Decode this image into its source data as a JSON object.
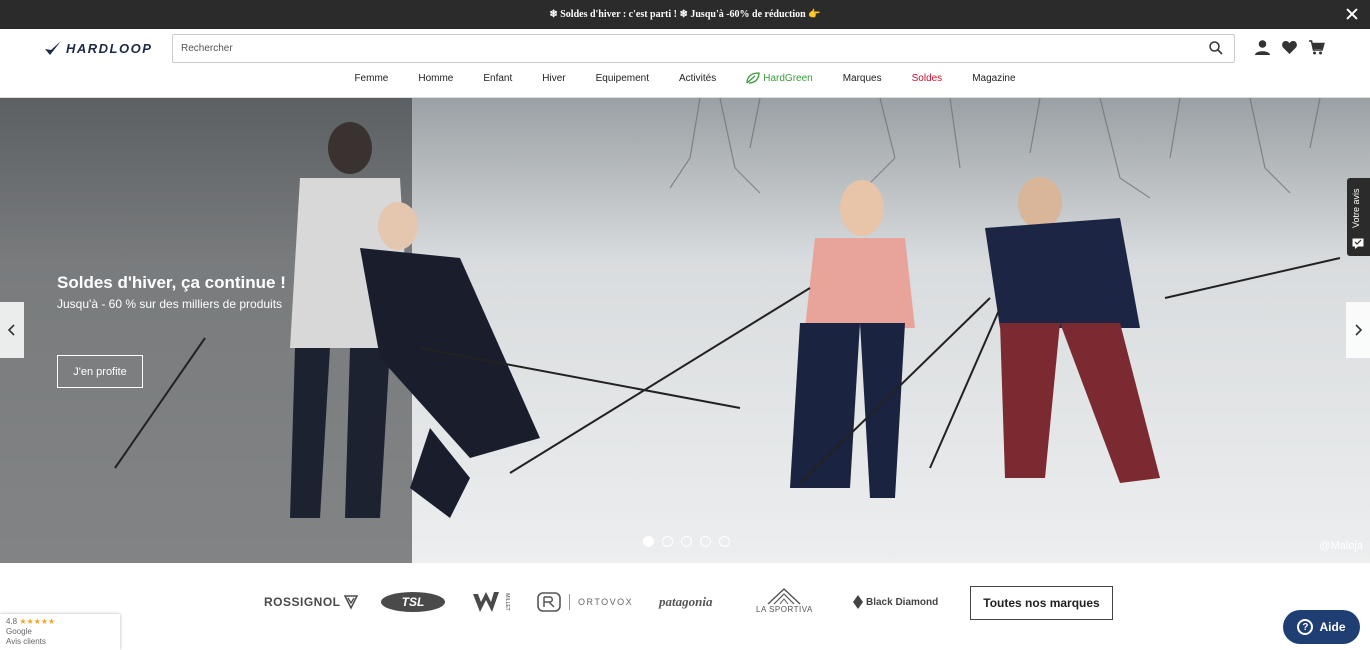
{
  "announcement": {
    "text": "❄ Soldes d'hiver : c'est parti ! ❄ Jusqu'à -60% de réduction 👉"
  },
  "header": {
    "logo_text": "HARDLOOP",
    "search_placeholder": "Rechercher",
    "icons": [
      "account-icon",
      "heart-icon",
      "cart-icon"
    ]
  },
  "nav": {
    "items": [
      {
        "label": "Femme"
      },
      {
        "label": "Homme"
      },
      {
        "label": "Enfant"
      },
      {
        "label": "Hiver"
      },
      {
        "label": "Equipement"
      },
      {
        "label": "Activités"
      },
      {
        "label": "HardGreen"
      },
      {
        "label": "Marques"
      },
      {
        "label": "Soldes"
      },
      {
        "label": "Magazine"
      }
    ],
    "colors": {
      "hardgreen": "#3a9b3a",
      "soldes": "#c8102e"
    }
  },
  "hero": {
    "title": "Soldes d'hiver, ça continue !",
    "subtitle": "Jusqu'à - 60 % sur des milliers de produits",
    "cta": "J'en profite",
    "credit": "@Maloja",
    "slides_count": 5,
    "active_slide": 1,
    "feedback_tab": "Votre avis"
  },
  "brands": {
    "items": [
      "ROSSIGNOL",
      "TSL",
      "MILLET",
      "ORTOVOX",
      "patagonia",
      "LA SPORTIVA",
      "Black Diamond"
    ],
    "all_label": "Toutes nos marques"
  },
  "google_badge": {
    "rating": "4.8",
    "stars": "★★★★★",
    "source": "Google",
    "caption": "Avis clients"
  },
  "help": {
    "label": "Aide"
  }
}
